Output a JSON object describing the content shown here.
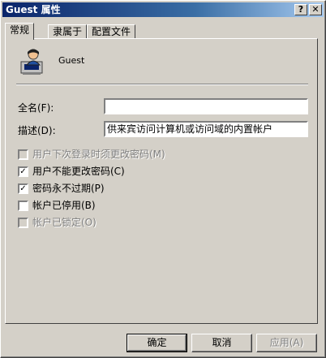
{
  "window": {
    "title": "Guest 属性"
  },
  "title_buttons": {
    "help": "?",
    "close": "✕"
  },
  "tabs": [
    {
      "label": "常规",
      "active": true
    },
    {
      "label": "隶属于",
      "active": false
    },
    {
      "label": "配置文件",
      "active": false
    }
  ],
  "user": {
    "name": "Guest",
    "icon": "user-computer-icon"
  },
  "fields": {
    "fullname_label": "全名(F):",
    "fullname_value": "",
    "description_label": "描述(D):",
    "description_value": "供来宾访问计算机或访问域的内置帐户"
  },
  "options": [
    {
      "label": "用户下次登录时须更改密码(M)",
      "checked": false,
      "enabled": false
    },
    {
      "label": "用户不能更改密码(C)",
      "checked": true,
      "enabled": true
    },
    {
      "label": "密码永不过期(P)",
      "checked": true,
      "enabled": true
    },
    {
      "label": "帐户已停用(B)",
      "checked": false,
      "enabled": true
    },
    {
      "label": "帐户已锁定(O)",
      "checked": false,
      "enabled": false
    }
  ],
  "buttons": {
    "ok": "确定",
    "cancel": "取消",
    "apply": "应用(A)"
  }
}
